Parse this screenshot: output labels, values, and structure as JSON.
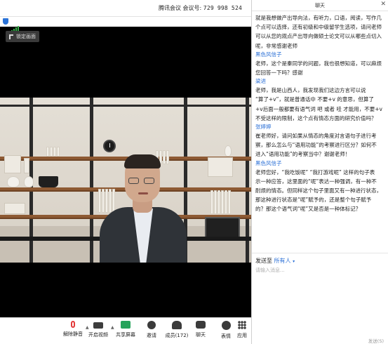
{
  "meeting": {
    "app_name": "腾讯会议",
    "id_label": "会议号:",
    "id_value": "729 998 524",
    "lock_button": "锁定画面"
  },
  "toolbar": {
    "items": [
      {
        "label": "解除静音",
        "icon": "mic-muted-icon"
      },
      {
        "label": "开启视频",
        "icon": "video-off-icon"
      },
      {
        "label": "共享屏幕",
        "icon": "share-screen-icon"
      },
      {
        "label": "邀请",
        "icon": "invite-icon"
      },
      {
        "label": "成员(172)",
        "icon": "members-icon"
      },
      {
        "label": "聊天",
        "icon": "chat-icon"
      },
      {
        "label": "表情",
        "icon": "emoji-icon"
      },
      {
        "label": "应用",
        "icon": "apps-icon"
      }
    ]
  },
  "chat": {
    "title": "聊天",
    "close": "✕",
    "send_to_label": "发送至",
    "send_to_target": "所有人",
    "input_placeholder": "请输入消息...",
    "send_button": "发送(S)",
    "messages": [
      {
        "sender": "",
        "lines": [
          "就是我想做产出导向法，有听力，口语，阅读，写作几",
          "个点可以选择，还有初级和中级留学生选项，请问老师",
          "可以从您的观点产出导向做硕士论文可以从哪些点切入",
          "呢，非常感谢老师"
        ]
      },
      {
        "sender": "黑色风信子",
        "lines": [
          "老师，这个是秦同学的问题，我也很想知道，可以麻烦",
          "您回答一下吗？感谢"
        ]
      },
      {
        "sender": "梁进",
        "lines": [
          "老师，我是山西人，我发现我们这边方言可以说",
          "“算了+v”，就是普通话中 不要+v 的意思，但算了",
          "+v后面一般都要有语气词 吧 或者 哇 才能用，不要+v",
          "不受这样的限制，这个点有情态方面的研究价值吗？"
        ]
      },
      {
        "sender": "张婷婷",
        "lines": [
          "崔老师好，请问如果从情态的角度对言语句子进行考",
          "察，那么怎么与“语用功能”的考察进行区分？如何不",
          "进入“语用功能”的考察当中？谢谢老师！"
        ]
      },
      {
        "sender": "黑色风信子",
        "lines": [
          "老师您好，“我吃饭呢” “我打游戏呢” 这样的句子表",
          "示一种应答，这里面的“呢”表达一种强调，有一种不",
          "耐烦的情态。但同样这个句子里面又有一种进行状态，",
          "那这种进行状态是“呢”赋予的，还是整个句子赋予",
          "的？那这个语气词“呢”又是否是一种体标记？"
        ]
      }
    ]
  },
  "colors": {
    "accent_blue": "#2a6fd6",
    "muted_red": "#e33b3b",
    "share_green": "#26a35b"
  }
}
